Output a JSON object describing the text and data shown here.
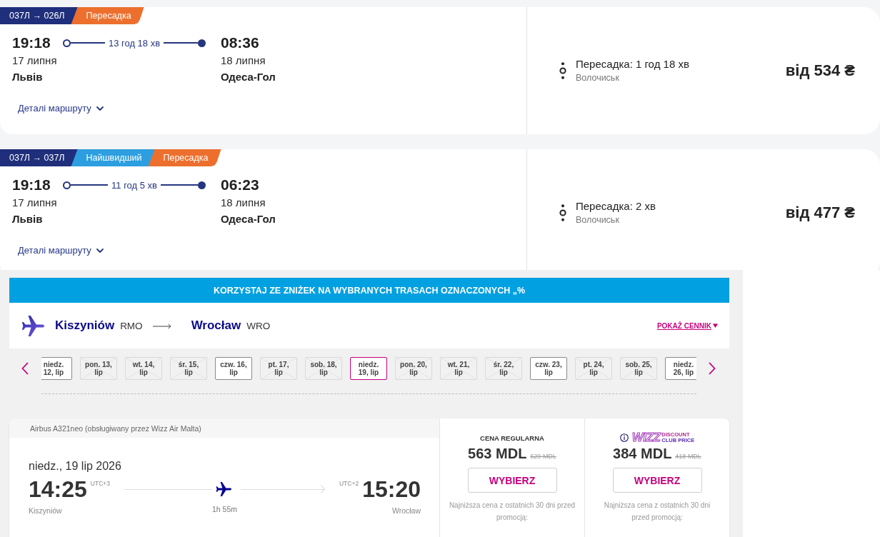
{
  "train_results": [
    {
      "badges": [
        {
          "kind": "route",
          "label": "037Л → 026Л"
        },
        {
          "kind": "transfer",
          "label": "Пересадка"
        }
      ],
      "departure": {
        "time": "19:18",
        "date": "17 липня",
        "station": "Львів"
      },
      "duration": "13 год 18 хв",
      "arrival": {
        "time": "08:36",
        "date": "18 липня",
        "station": "Одеса-Гол"
      },
      "details_link": "Деталі маршруту",
      "transfer": {
        "label": "Пересадка: 1 год 18 хв",
        "station": "Волочиськ"
      },
      "price": "від 534 ₴"
    },
    {
      "badges": [
        {
          "kind": "route",
          "label": "037Л → 037Л"
        },
        {
          "kind": "fastest",
          "label": "Найшвидший"
        },
        {
          "kind": "transfer",
          "label": "Пересадка"
        }
      ],
      "departure": {
        "time": "19:18",
        "date": "17 липня",
        "station": "Львів"
      },
      "duration": "11 год 5 хв",
      "arrival": {
        "time": "06:23",
        "date": "18 липня",
        "station": "Одеса-Гол"
      },
      "details_link": "Деталі маршруту",
      "transfer": {
        "label": "Пересадка: 2 хв",
        "station": "Волочиськ"
      },
      "price": "від 477 ₴"
    }
  ],
  "wizz": {
    "promo_banner": "KORZYSTAJ ZE ZNIŻEK NA WYBRANYCH TRASACH OZNACZONYCH „%",
    "route": {
      "origin": "Kiszyniów",
      "origin_code": "RMO",
      "destination": "Wrocław",
      "destination_code": "WRO"
    },
    "price_list_link": "POKAŻ CENNIK",
    "dates": [
      {
        "label": "niedz. 12, lip",
        "available": true,
        "selected": false
      },
      {
        "label": "pon. 13, lip",
        "available": false,
        "selected": false
      },
      {
        "label": "wt. 14, lip",
        "available": false,
        "selected": false
      },
      {
        "label": "śr. 15, lip",
        "available": false,
        "selected": false
      },
      {
        "label": "czw. 16, lip",
        "available": true,
        "selected": false
      },
      {
        "label": "pt. 17, lip",
        "available": false,
        "selected": false
      },
      {
        "label": "sob. 18, lip",
        "available": false,
        "selected": false
      },
      {
        "label": "niedz. 19, lip",
        "available": true,
        "selected": true
      },
      {
        "label": "pon. 20, lip",
        "available": false,
        "selected": false
      },
      {
        "label": "wt. 21, lip",
        "available": false,
        "selected": false
      },
      {
        "label": "śr. 22, lip",
        "available": false,
        "selected": false
      },
      {
        "label": "czw. 23, lip",
        "available": true,
        "selected": false
      },
      {
        "label": "pt. 24, lip",
        "available": false,
        "selected": false
      },
      {
        "label": "sob. 25, lip",
        "available": false,
        "selected": false
      },
      {
        "label": "niedz. 26, lip",
        "available": true,
        "selected": false
      }
    ],
    "flight": {
      "aircraft": "Airbus A321neo (obsługiwany przez Wizz Air Malta)",
      "date": "niedz., 19 lip 2026",
      "departure": {
        "time": "14:25",
        "utc": "UTC+3",
        "city": "Kiszyniów"
      },
      "duration": "1h 55m",
      "arrival": {
        "time": "15:20",
        "utc": "UTC+2",
        "city": "Wrocław"
      }
    },
    "fares": [
      {
        "kind": "regular",
        "title": "CENA REGULARNA",
        "price": "563 MDL",
        "old_price": "629 MDL",
        "button": "WYBIERZ",
        "note": "Najniższa cena z ostatnich 30 dni przed promocją:"
      },
      {
        "kind": "club",
        "logo": {
          "mark": "WIZZ",
          "lines": [
            "DISCOUNT",
            "CLUB PRICE"
          ]
        },
        "price": "384 MDL",
        "old_price": "418 MDL",
        "button": "WYBIERZ",
        "note": "Najniższa cena z ostatnich 30 dni przed promocją:"
      }
    ]
  }
}
